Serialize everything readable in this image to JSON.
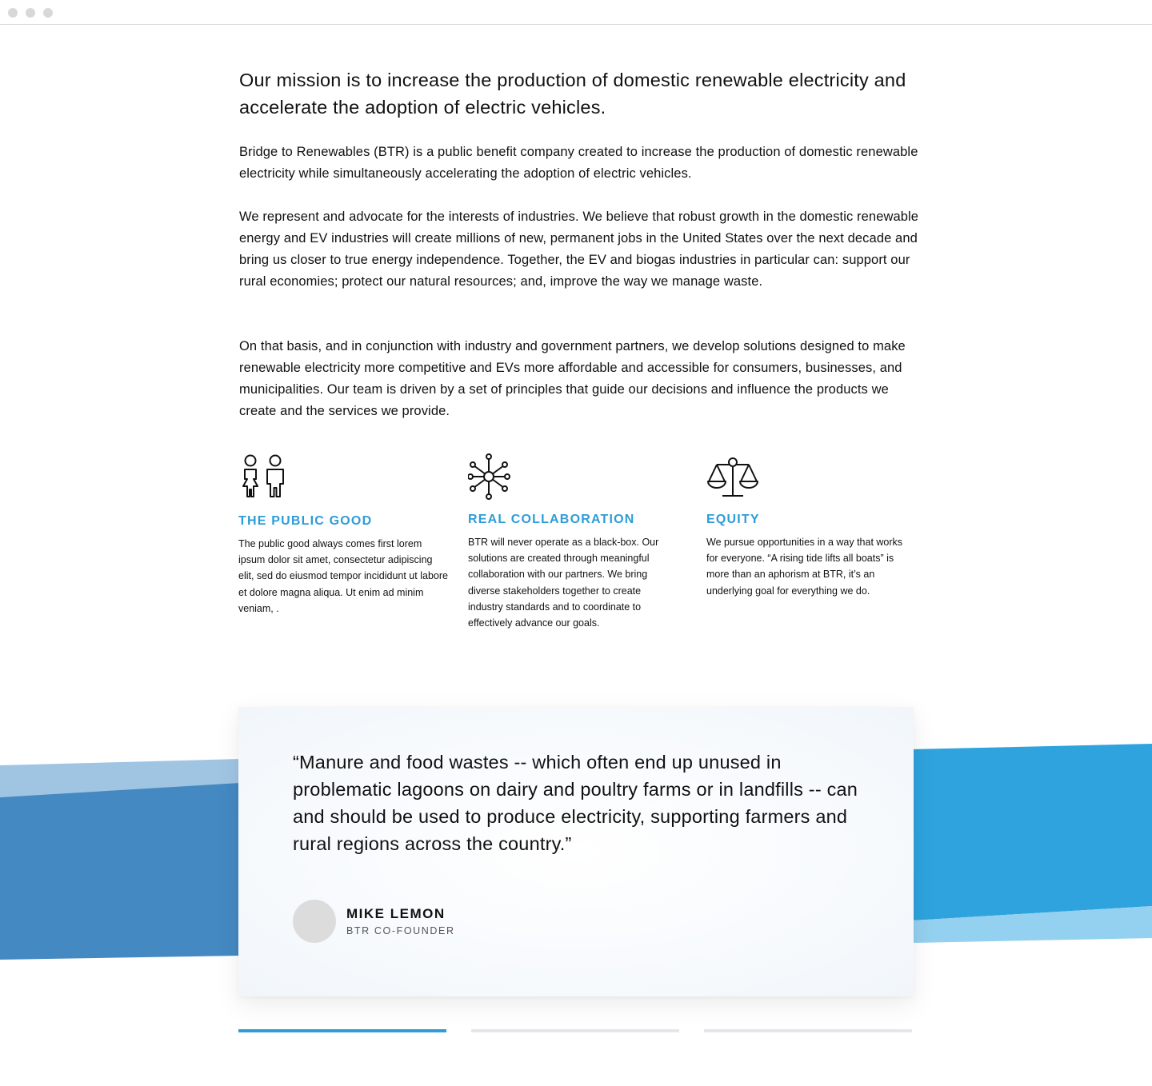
{
  "about": {
    "mission": "Our mission is to increase the production of domestic renewable electricity and accelerate the adoption of electric vehicles.",
    "paragraphs": [
      "Bridge to Renewables (BTR) is a public benefit company created to increase the production of domestic renewable electricity while simultaneously accelerating the adoption of electric vehicles.",
      "We represent and advocate for the interests of industries. We believe that robust growth in the domestic renewable energy and EV industries will create millions of new, permanent jobs in the United States over the next decade and bring us closer to true energy independence. Together, the EV and biogas industries in particular can: support our rural economies; protect our natural resources; and, improve the way we manage waste.",
      "On that basis, and in conjunction with industry and government partners, we develop solutions designed to make renewable electricity more competitive and EVs more affordable and accessible for consumers, businesses, and municipalities. Our team is driven by a set of principles that guide our decisions and influence the products we create and the services we provide."
    ]
  },
  "principles": [
    {
      "icon": "people-icon",
      "title": "THE PUBLIC GOOD",
      "text": "The public good always comes first lorem ipsum dolor sit amet, consectetur adipiscing elit, sed do eiusmod tempor incididunt ut labore et dolore magna aliqua. Ut enim ad minim veniam, ."
    },
    {
      "icon": "network-icon",
      "title": "REAL COLLABORATION",
      "text": "BTR will never operate as a black-box. Our solutions are created through meaningful collaboration with our partners. We bring diverse stakeholders together to create industry standards and to coordinate to effectively advance our goals."
    },
    {
      "icon": "scales-icon",
      "title": "EQUITY",
      "text": "We pursue opportunities in a way that works for everyone. “A rising tide lifts all boats” is more than an aphorism at BTR, it’s an underlying goal for everything we do."
    }
  ],
  "testimonial": {
    "quote": "“Manure and food wastes -- which often end up unused in problematic lagoons on dairy and poultry farms or in landfills -- can and should be used to produce electricity, supporting farmers and rural regions across the country.”",
    "author": "MIKE LEMON",
    "role": "BTR CO-FOUNDER"
  },
  "carousel": {
    "count": 3,
    "active_index": 0
  },
  "colors": {
    "accent": "#2d9cd8",
    "band_dark": "#4589c3",
    "band_light": "#a0c5e3",
    "band_bright": "#2ea3dd",
    "band_bright_light": "#94d0ef",
    "inactive_indicator": "#e4e6e9"
  }
}
